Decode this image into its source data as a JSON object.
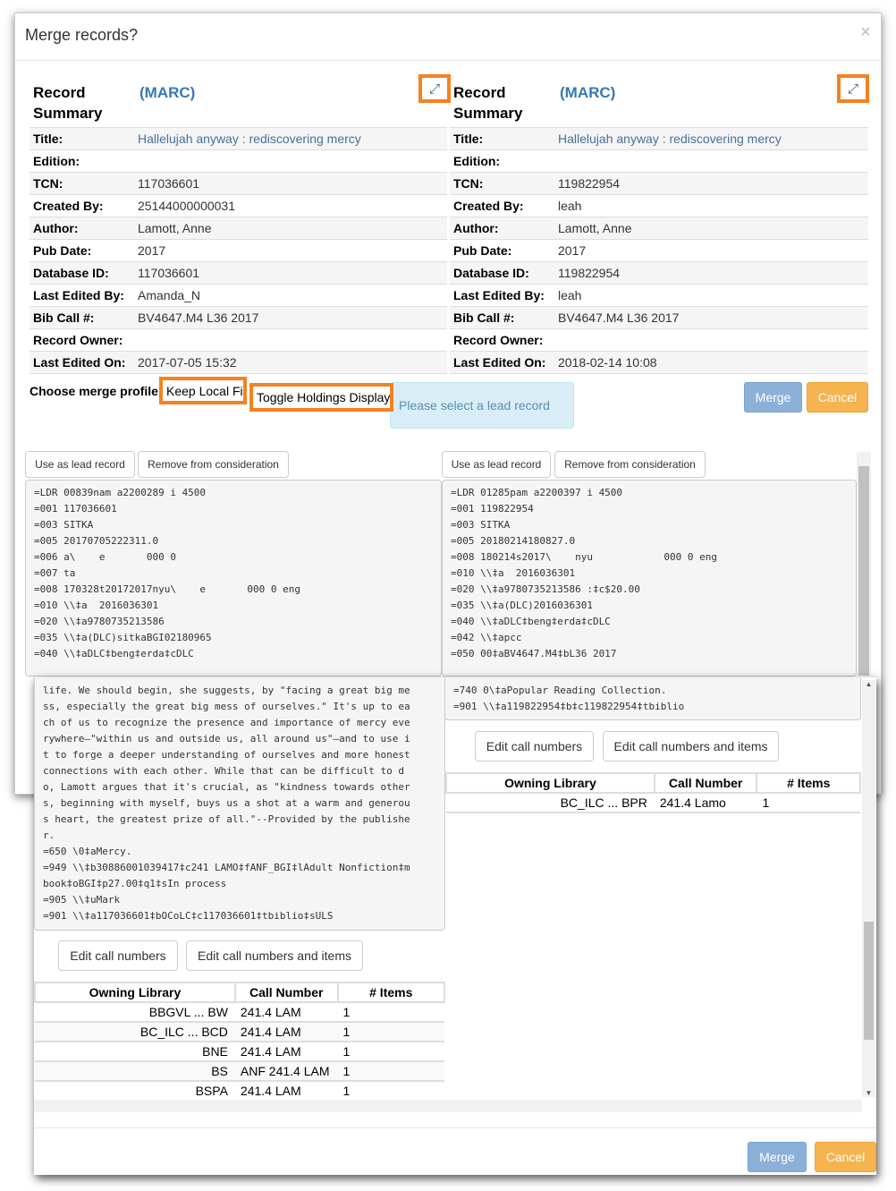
{
  "dialog": {
    "title": "Merge records?",
    "close": "×"
  },
  "records": [
    {
      "heading": "Record Summary",
      "format": "(MARC)",
      "fields": [
        {
          "k": "Title:",
          "v": "Hallelujah anyway : rediscovering mercy"
        },
        {
          "k": "Edition:",
          "v": ""
        },
        {
          "k": "TCN:",
          "v": "117036601"
        },
        {
          "k": "Created By:",
          "v": "25144000000031"
        },
        {
          "k": "Author:",
          "v": "Lamott, Anne"
        },
        {
          "k": "Pub Date:",
          "v": "2017"
        },
        {
          "k": "Database ID:",
          "v": "117036601"
        },
        {
          "k": "Last Edited By:",
          "v": "Amanda_N"
        },
        {
          "k": "Bib Call #:",
          "v": "BV4647.M4 L36 2017"
        },
        {
          "k": "Record Owner:",
          "v": ""
        },
        {
          "k": "Last Edited On:",
          "v": "2017-07-05 15:32"
        }
      ]
    },
    {
      "heading": "Record Summary",
      "format": "(MARC)",
      "fields": [
        {
          "k": "Title:",
          "v": "Hallelujah anyway : rediscovering mercy"
        },
        {
          "k": "Edition:",
          "v": ""
        },
        {
          "k": "TCN:",
          "v": "119822954"
        },
        {
          "k": "Created By:",
          "v": "leah"
        },
        {
          "k": "Author:",
          "v": "Lamott, Anne"
        },
        {
          "k": "Pub Date:",
          "v": "2017"
        },
        {
          "k": "Database ID:",
          "v": "119822954"
        },
        {
          "k": "Last Edited By:",
          "v": "leah"
        },
        {
          "k": "Bib Call #:",
          "v": "BV4647.M4 L36 2017"
        },
        {
          "k": "Record Owner:",
          "v": ""
        },
        {
          "k": "Last Edited On:",
          "v": "2018-02-14 10:08"
        }
      ]
    }
  ],
  "profile": {
    "label": "Choose merge profile",
    "value": "Keep Local Fi",
    "toggle": "Toggle Holdings Display",
    "tooltip": "Please select a lead record"
  },
  "actions": {
    "merge": "Merge",
    "cancel": "Cancel",
    "use_lead": "Use as lead record",
    "remove": "Remove from consideration",
    "edit_cn": "Edit call numbers",
    "edit_cn_items": "Edit call numbers and items"
  },
  "marc_left_top": "=LDR 00839nam a2200289 i 4500\n=001 117036601\n=003 SITKA\n=005 20170705222311.0\n=006 a\\    e       000 0\n=007 ta\n=008 170328t20172017nyu\\    e       000 0 eng\n=010 \\\\‡a  2016036301\n=020 \\\\‡a9780735213586\n=035 \\\\‡a(DLC)sitkaBGI02180965\n=040 \\\\‡aDLC‡beng‡erda‡cDLC",
  "marc_right_top": "=LDR 01285pam a2200397 i 4500\n=001 119822954\n=003 SITKA\n=005 20180214180827.0\n=008 180214s2017\\    nyu            000 0 eng\n=010 \\\\‡a  2016036301\n=020 \\\\‡a9780735213586 :‡c$20.00\n=035 \\\\‡a(DLC)2016036301\n=040 \\\\‡aDLC‡beng‡erda‡cDLC\n=042 \\\\‡apcc\n=050 00‡aBV4647.M4‡bL36 2017",
  "marc_left_bottom": "life. We should begin, she suggests, by \"facing a great big me\nss, especially the great big mess of ourselves.\" It's up to ea\nch of us to recognize the presence and importance of mercy eve\nrywhere—\"within us and outside us, all around us\"—and to use i\nt to forge a deeper understanding of ourselves and more honest\nconnections with each other. While that can be difficult to d\no, Lamott argues that it's crucial, as \"kindness towards other\ns, beginning with myself, buys us a shot at a warm and generou\ns heart, the greatest prize of all.\"--Provided by the publishe\nr.\n=650 \\0‡aMercy.\n=949 \\\\‡b30886001039417‡c241 LAMO‡fANF_BGI‡lAdult Nonfiction‡m\nbook‡oBGI‡p27.00‡q1‡sIn process\n=905 \\\\‡uMark\n=901 \\\\‡a117036601‡bOCoLC‡c117036601‡tbiblio‡sULS",
  "marc_right_bottom": "=740 0\\‡aPopular Reading Collection.\n=901 \\\\‡a119822954‡b‡c119822954‡tbiblio",
  "holdings": {
    "headers": [
      "Owning Library",
      "Call Number",
      "# Items"
    ],
    "left": [
      [
        "BBGVL ... BW",
        "241.4 LAM",
        "1"
      ],
      [
        "BC_ILC ... BCD",
        "241.4 LAM",
        "1"
      ],
      [
        "BNE",
        "241.4 LAM",
        "1"
      ],
      [
        "BS",
        "ANF 241.4 LAM",
        "1"
      ],
      [
        "BSPA",
        "241.4 LAM",
        "1"
      ]
    ],
    "right": [
      [
        "BC_ILC ... BPR",
        "241.4 Lamo",
        "1"
      ]
    ]
  },
  "colors": {
    "highlight": "#f58220",
    "link": "#337ab7",
    "merge": "#8cb1d9",
    "cancel": "#f5b44f"
  }
}
